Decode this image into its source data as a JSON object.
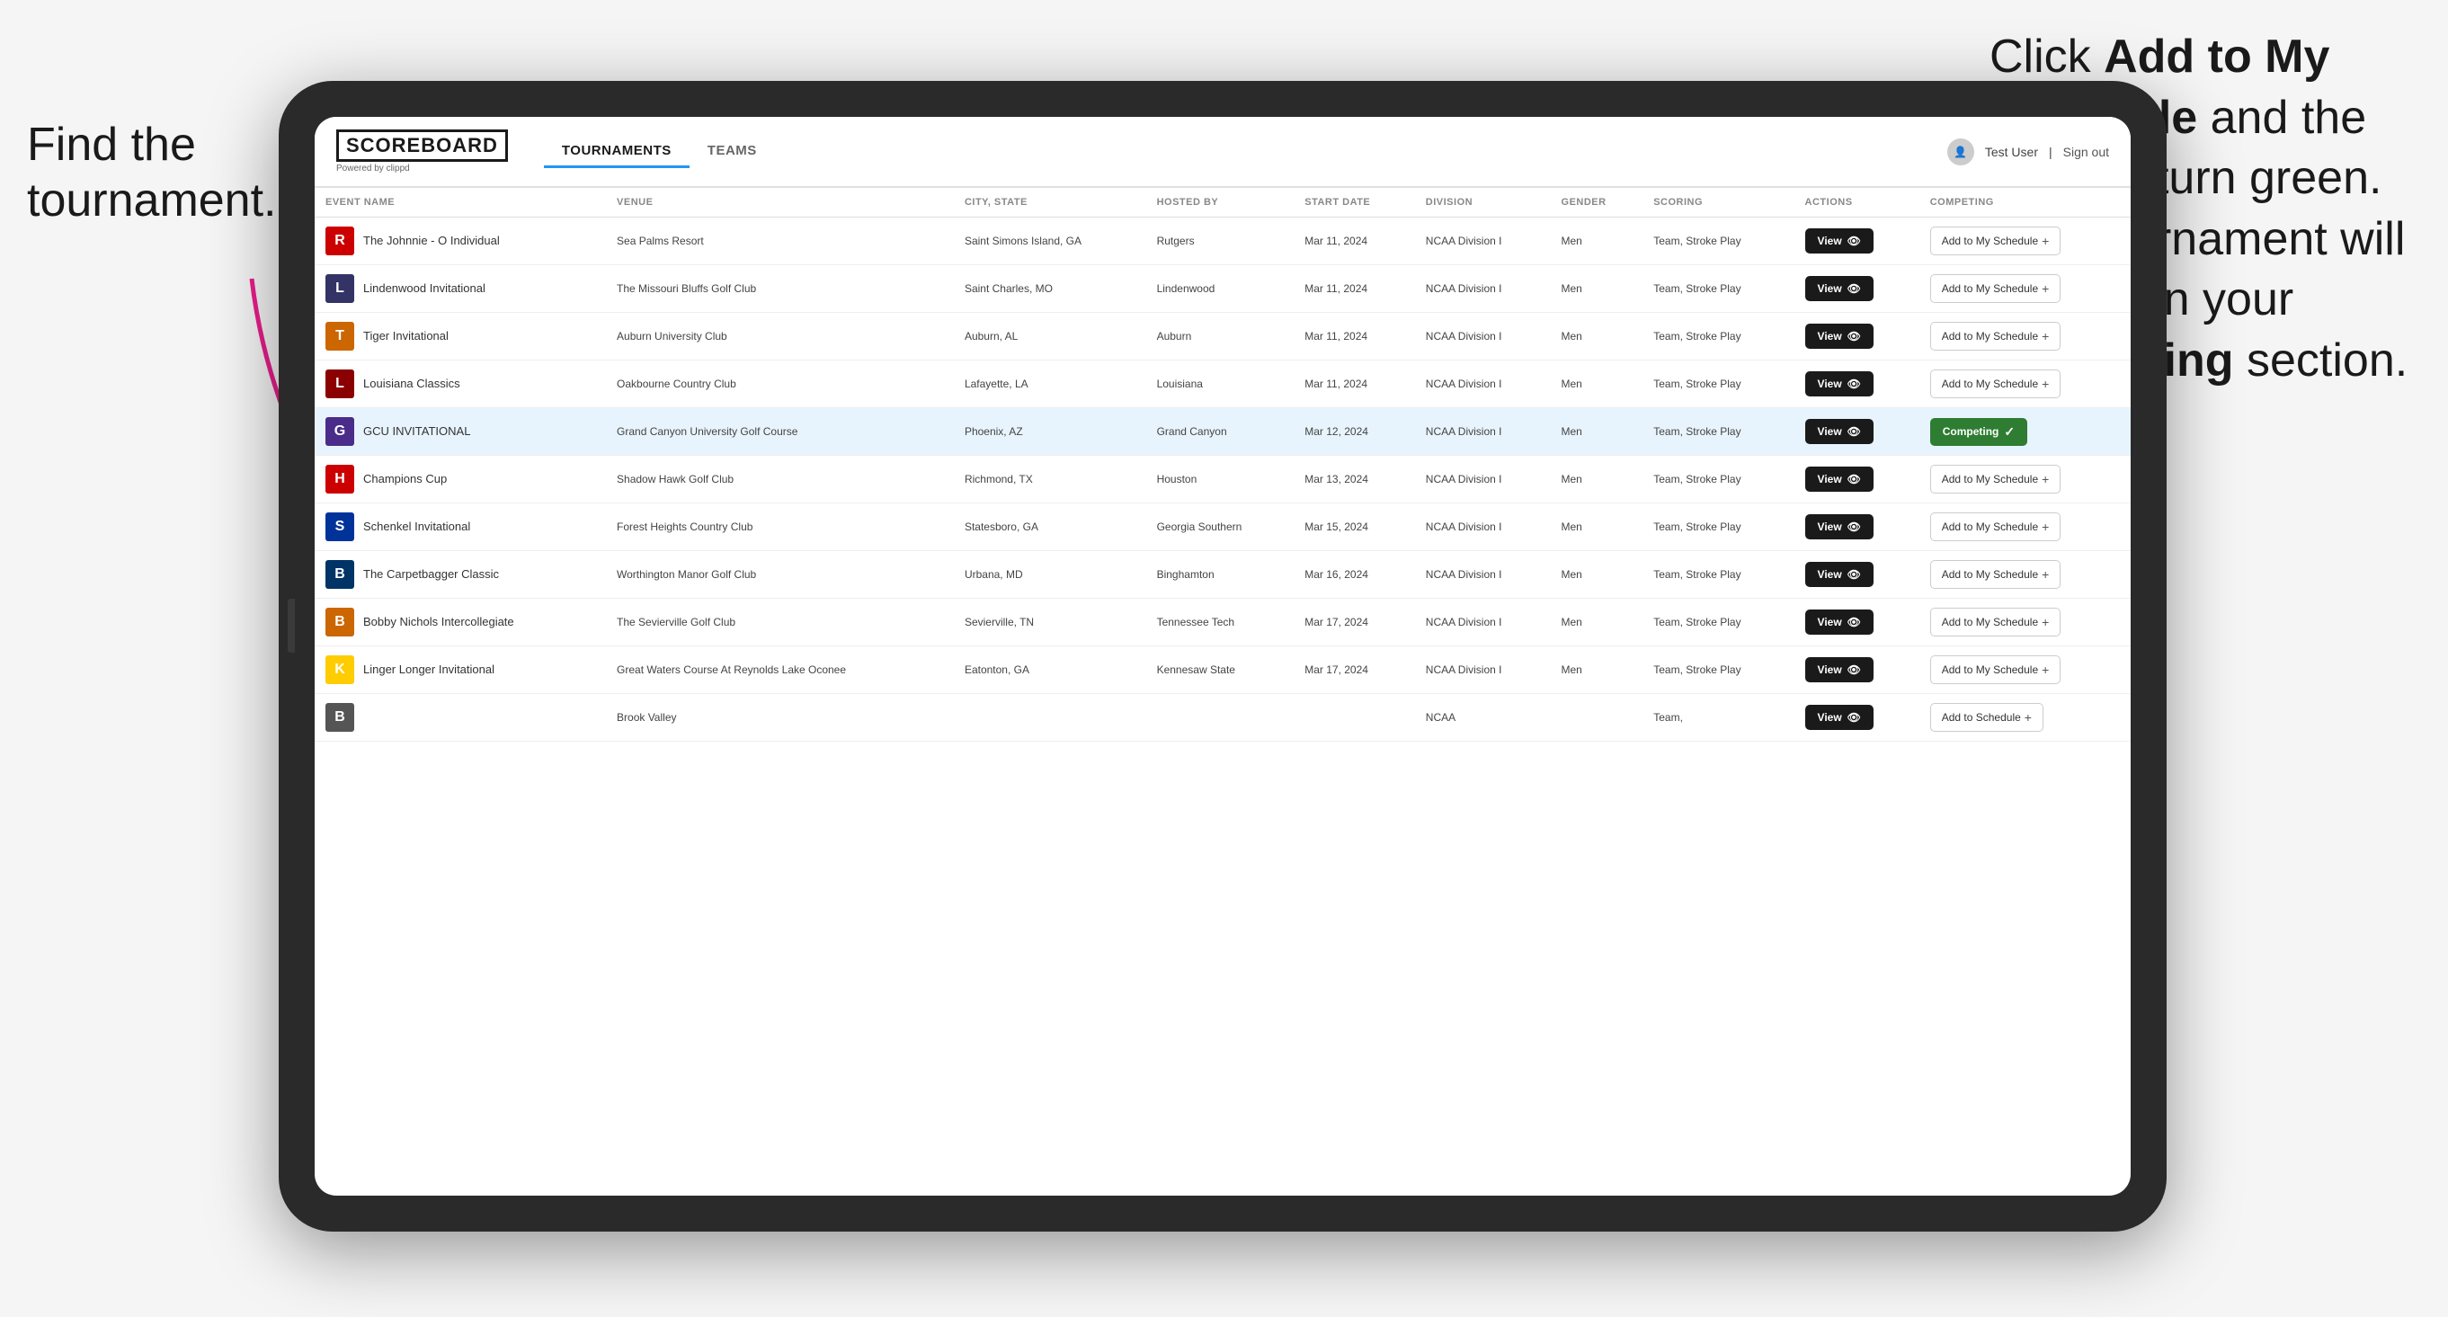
{
  "annotations": {
    "left_title": "Find the",
    "left_title2": "tournament.",
    "right_text_1": "Click ",
    "right_bold_1": "Add to My Schedule",
    "right_text_2": " and the box will turn green. This tournament will now be in your ",
    "right_bold_2": "Competing",
    "right_text_3": " section."
  },
  "header": {
    "logo": "SCOREBOARD",
    "logo_sub": "Powered by clippd",
    "nav": [
      "TOURNAMENTS",
      "TEAMS"
    ],
    "active_nav": "TOURNAMENTS",
    "user": "Test User",
    "sign_out": "Sign out"
  },
  "table": {
    "columns": [
      "EVENT NAME",
      "VENUE",
      "CITY, STATE",
      "HOSTED BY",
      "START DATE",
      "DIVISION",
      "GENDER",
      "SCORING",
      "ACTIONS",
      "COMPETING"
    ],
    "rows": [
      {
        "logo_char": "R",
        "logo_color": "#cc0000",
        "event_name": "The Johnnie - O Individual",
        "venue": "Sea Palms Resort",
        "city_state": "Saint Simons Island, GA",
        "hosted_by": "Rutgers",
        "start_date": "Mar 11, 2024",
        "division": "NCAA Division I",
        "gender": "Men",
        "scoring": "Team, Stroke Play",
        "action": "View",
        "competing": "Add to My Schedule",
        "competing_type": "add",
        "highlighted": false
      },
      {
        "logo_char": "L",
        "logo_color": "#333366",
        "event_name": "Lindenwood Invitational",
        "venue": "The Missouri Bluffs Golf Club",
        "city_state": "Saint Charles, MO",
        "hosted_by": "Lindenwood",
        "start_date": "Mar 11, 2024",
        "division": "NCAA Division I",
        "gender": "Men",
        "scoring": "Team, Stroke Play",
        "action": "View",
        "competing": "Add to My Schedule",
        "competing_type": "add",
        "highlighted": false
      },
      {
        "logo_char": "T",
        "logo_color": "#cc6600",
        "event_name": "Tiger Invitational",
        "venue": "Auburn University Club",
        "city_state": "Auburn, AL",
        "hosted_by": "Auburn",
        "start_date": "Mar 11, 2024",
        "division": "NCAA Division I",
        "gender": "Men",
        "scoring": "Team, Stroke Play",
        "action": "View",
        "competing": "Add to My Schedule",
        "competing_type": "add",
        "highlighted": false
      },
      {
        "logo_char": "L",
        "logo_color": "#8B0000",
        "event_name": "Louisiana Classics",
        "venue": "Oakbourne Country Club",
        "city_state": "Lafayette, LA",
        "hosted_by": "Louisiana",
        "start_date": "Mar 11, 2024",
        "division": "NCAA Division I",
        "gender": "Men",
        "scoring": "Team, Stroke Play",
        "action": "View",
        "competing": "Add to My Schedule",
        "competing_type": "add",
        "highlighted": false
      },
      {
        "logo_char": "G",
        "logo_color": "#4a2c8a",
        "event_name": "GCU INVITATIONAL",
        "venue": "Grand Canyon University Golf Course",
        "city_state": "Phoenix, AZ",
        "hosted_by": "Grand Canyon",
        "start_date": "Mar 12, 2024",
        "division": "NCAA Division I",
        "gender": "Men",
        "scoring": "Team, Stroke Play",
        "action": "View",
        "competing": "Competing",
        "competing_type": "competing",
        "highlighted": true
      },
      {
        "logo_char": "H",
        "logo_color": "#cc0000",
        "event_name": "Champions Cup",
        "venue": "Shadow Hawk Golf Club",
        "city_state": "Richmond, TX",
        "hosted_by": "Houston",
        "start_date": "Mar 13, 2024",
        "division": "NCAA Division I",
        "gender": "Men",
        "scoring": "Team, Stroke Play",
        "action": "View",
        "competing": "Add to My Schedule",
        "competing_type": "add",
        "highlighted": false
      },
      {
        "logo_char": "S",
        "logo_color": "#003399",
        "event_name": "Schenkel Invitational",
        "venue": "Forest Heights Country Club",
        "city_state": "Statesboro, GA",
        "hosted_by": "Georgia Southern",
        "start_date": "Mar 15, 2024",
        "division": "NCAA Division I",
        "gender": "Men",
        "scoring": "Team, Stroke Play",
        "action": "View",
        "competing": "Add to My Schedule",
        "competing_type": "add",
        "highlighted": false
      },
      {
        "logo_char": "B",
        "logo_color": "#003366",
        "event_name": "The Carpetbagger Classic",
        "venue": "Worthington Manor Golf Club",
        "city_state": "Urbana, MD",
        "hosted_by": "Binghamton",
        "start_date": "Mar 16, 2024",
        "division": "NCAA Division I",
        "gender": "Men",
        "scoring": "Team, Stroke Play",
        "action": "View",
        "competing": "Add to My Schedule",
        "competing_type": "add",
        "highlighted": false
      },
      {
        "logo_char": "B",
        "logo_color": "#cc6600",
        "event_name": "Bobby Nichols Intercollegiate",
        "venue": "The Sevierville Golf Club",
        "city_state": "Sevierville, TN",
        "hosted_by": "Tennessee Tech",
        "start_date": "Mar 17, 2024",
        "division": "NCAA Division I",
        "gender": "Men",
        "scoring": "Team, Stroke Play",
        "action": "View",
        "competing": "Add to My Schedule",
        "competing_type": "add",
        "highlighted": false
      },
      {
        "logo_char": "K",
        "logo_color": "#ffcc00",
        "event_name": "Linger Longer Invitational",
        "venue": "Great Waters Course At Reynolds Lake Oconee",
        "city_state": "Eatonton, GA",
        "hosted_by": "Kennesaw State",
        "start_date": "Mar 17, 2024",
        "division": "NCAA Division I",
        "gender": "Men",
        "scoring": "Team, Stroke Play",
        "action": "View",
        "competing": "Add to My Schedule",
        "competing_type": "add",
        "highlighted": false
      },
      {
        "logo_char": "B",
        "logo_color": "#555555",
        "event_name": "",
        "venue": "Brook Valley",
        "city_state": "",
        "hosted_by": "",
        "start_date": "",
        "division": "NCAA",
        "gender": "",
        "scoring": "Team,",
        "action": "View",
        "competing": "Add to Schedule",
        "competing_type": "add",
        "highlighted": false
      }
    ]
  },
  "buttons": {
    "view_label": "View",
    "add_schedule_label": "Add to My Schedule",
    "competing_label": "Competing"
  }
}
